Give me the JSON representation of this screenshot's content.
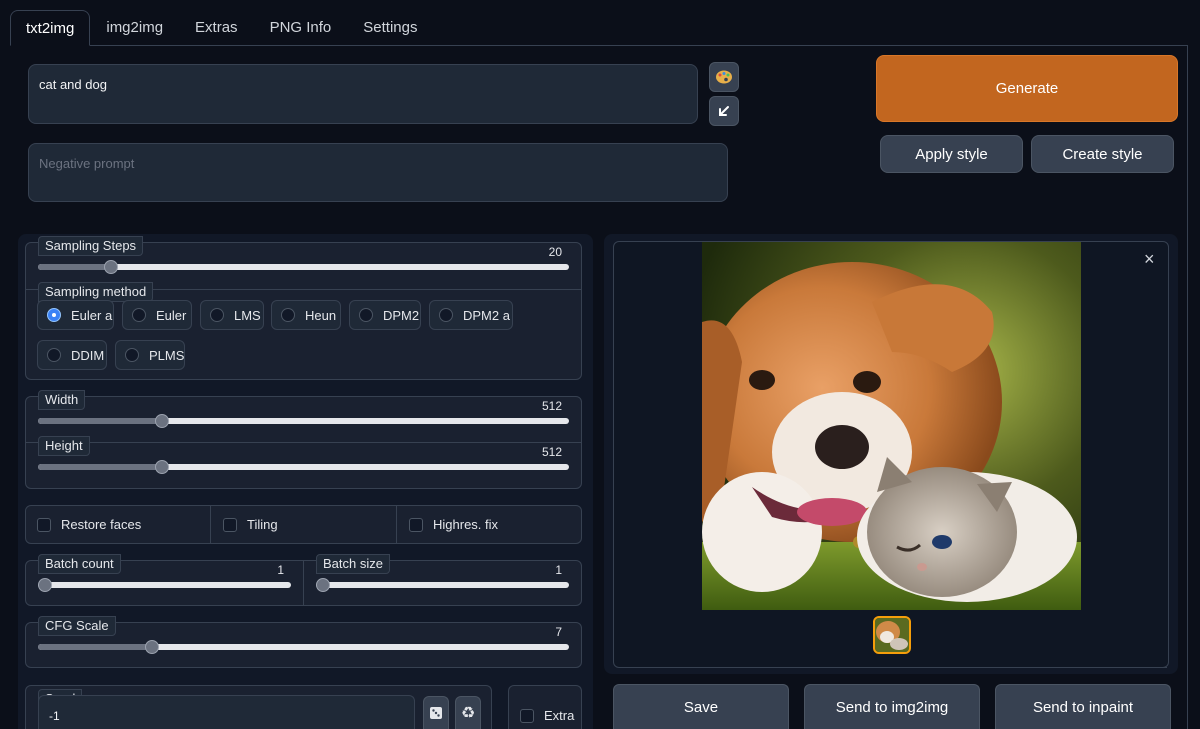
{
  "tabs": [
    "txt2img",
    "img2img",
    "Extras",
    "PNG Info",
    "Settings"
  ],
  "prompt": {
    "value": "cat and dog",
    "negative_placeholder": "Negative prompt"
  },
  "prompt_tools": {
    "paint_icon": "palette-icon",
    "arrow_icon": "arrow-down-left-icon"
  },
  "actions": {
    "generate": "Generate",
    "apply_style": "Apply style",
    "create_style": "Create style"
  },
  "sampling": {
    "steps_label": "Sampling Steps",
    "steps_value": "20",
    "method_label": "Sampling method",
    "methods": [
      "Euler a",
      "Euler",
      "LMS",
      "Heun",
      "DPM2",
      "DPM2 a",
      "DDIM",
      "PLMS"
    ],
    "selected": "Euler a"
  },
  "size": {
    "width_label": "Width",
    "width_value": "512",
    "height_label": "Height",
    "height_value": "512"
  },
  "options": {
    "restore_faces": "Restore faces",
    "tiling": "Tiling",
    "highres": "Highres. fix"
  },
  "batch": {
    "count_label": "Batch count",
    "count_value": "1",
    "size_label": "Batch size",
    "size_value": "1"
  },
  "cfg": {
    "label": "CFG Scale",
    "value": "7"
  },
  "seed": {
    "label": "Seed",
    "value": "-1",
    "extra": "Extra"
  },
  "output": {
    "save": "Save",
    "send_img2img": "Send to img2img",
    "send_inpaint": "Send to inpaint",
    "close": "×"
  },
  "colors": {
    "accent": "#c2661f",
    "background": "#0b0f19",
    "panel": "#1f2937"
  }
}
